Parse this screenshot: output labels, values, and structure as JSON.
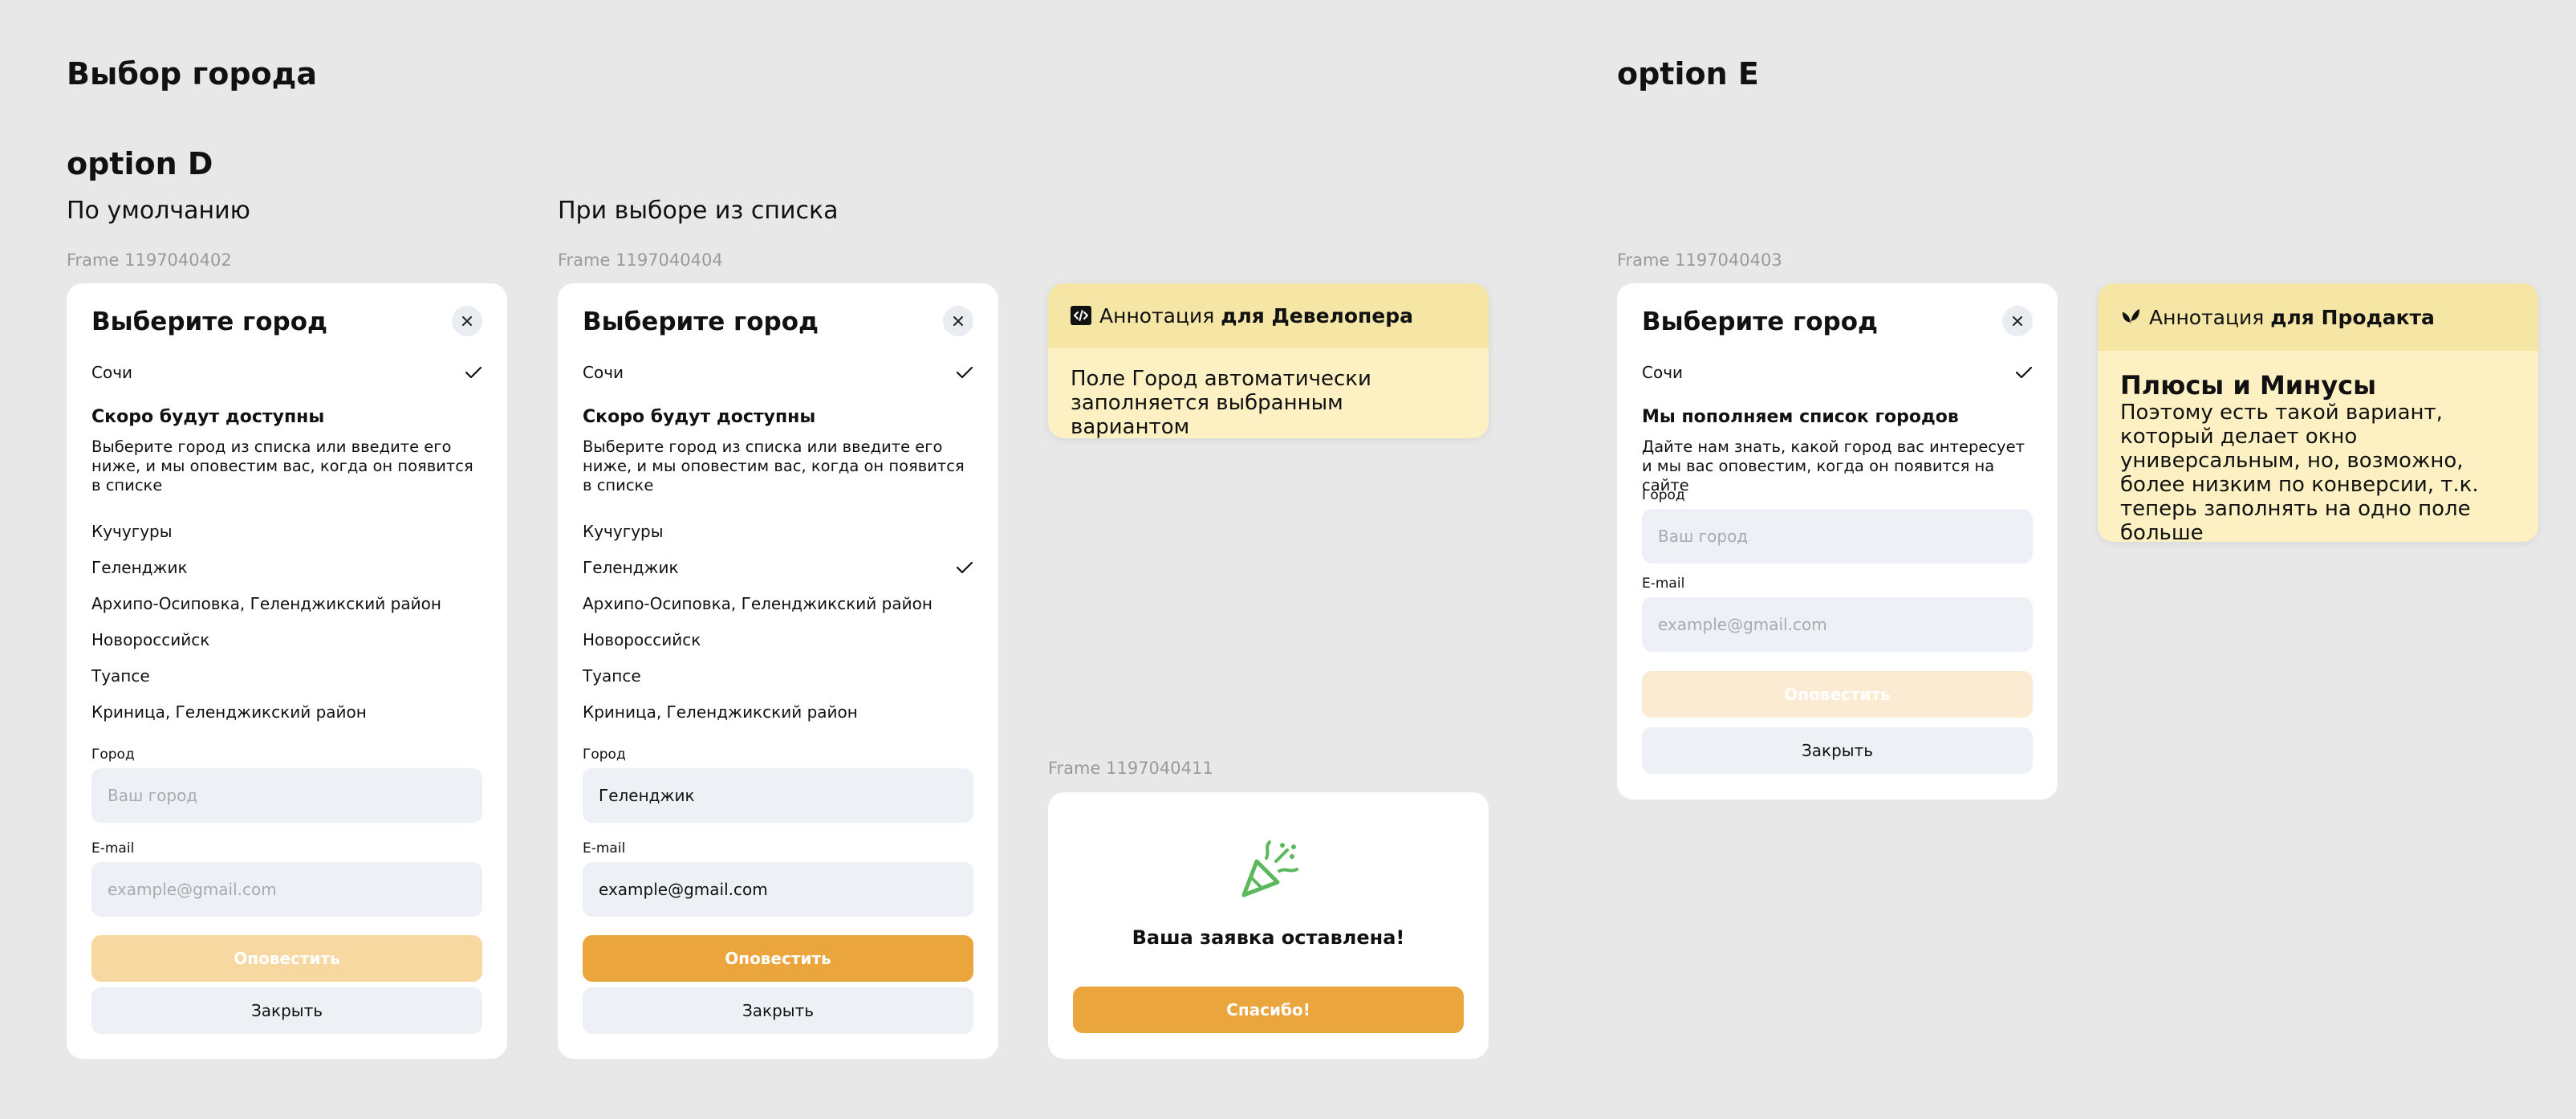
{
  "page": {
    "title_left": "Выбор города",
    "title_right": "option E",
    "option_d": "option D",
    "col1_subtitle": "По умолчанию",
    "col2_subtitle": "При выборе из списка"
  },
  "frames": {
    "f402": "Frame 1197040402",
    "f404": "Frame 1197040404",
    "f411": "Frame 1197040411",
    "f403": "Frame 1197040403"
  },
  "modal_d": {
    "title": "Выберите город",
    "selected_city": "Сочи",
    "soon_title": "Скоро будут доступны",
    "soon_desc": "Выберите город из списка или введите его ниже, и мы оповестим вас, когда он появится в списке",
    "cities": [
      "Кучугуры",
      "Геленджик",
      "Архипо-Осиповка, Геленджикский район",
      "Новороссийск",
      "Туапсе",
      "Криница, Геленджикский район"
    ],
    "city_label": "Город",
    "city_placeholder": "Ваш город",
    "email_label": "E-mail",
    "email_placeholder": "example@gmail.com",
    "notify_label": "Оповестить",
    "close_label": "Закрыть"
  },
  "modal_d2": {
    "city_value": "Геленджик",
    "email_value": "example@gmail.com"
  },
  "dev_annotation": {
    "prefix": "Аннотация",
    "suffix": "для Девелопера",
    "text": "Поле Город автоматически заполняется выбранным вариантом"
  },
  "success": {
    "message": "Ваша заявка оставлена!",
    "button": "Спасибо!"
  },
  "modal_e": {
    "title": "Выберите город",
    "selected_city": "Сочи",
    "section_title": "Мы пополняем список городов",
    "section_desc": "Дайте нам знать, какой город вас интересует и мы вас оповестим, когда он появится на сайте",
    "city_label": "Город",
    "city_placeholder": "Ваш город",
    "email_label": "E-mail",
    "email_placeholder": "example@gmail.com",
    "notify_label": "Оповестить",
    "close_label": "Закрыть"
  },
  "product_annotation": {
    "prefix": "Аннотация",
    "suffix": "для Продакта",
    "title": "Плюсы и Минусы",
    "text": "Поэтому есть такой вариант, который делает окно универсальным, но, возможно, более низким по конверсии, т.к. теперь заполнять на одно поле больше"
  },
  "colors": {
    "background": "#e8e8e8",
    "primary_button": "#eaa53c",
    "disabled_button": "#f7d8a0",
    "input_bg": "#edf1f5",
    "annotation_bg": "#fdf1c3",
    "annotation_header": "#f5e6a6",
    "success_icon": "#5cb85c"
  },
  "icons": [
    "close-icon",
    "check-icon",
    "code-icon",
    "leaf-icon",
    "party-popper-icon"
  ]
}
